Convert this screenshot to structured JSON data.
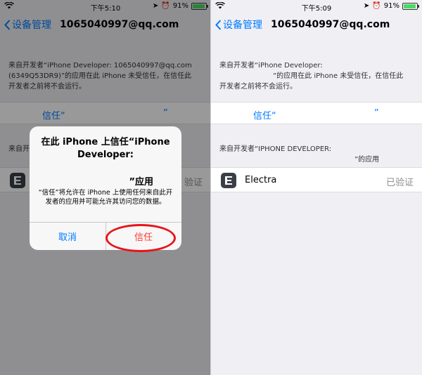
{
  "left": {
    "status": {
      "time": "下午5:10",
      "battery": "91%"
    },
    "nav": {
      "back": "设备管理",
      "title": "1065040997@qq.com"
    },
    "desc": [
      "来自开发者“iPhone Developer: 1065040997@qq.com",
      "(6349Q53DR9)”的应用在此 iPhone 未受信任，在信任此",
      "开发者之前将不会运行。"
    ],
    "trust_label": "信任“",
    "trust_close": "”",
    "section2": "来自开发者",
    "app_status": "验证",
    "alert": {
      "title_line1": "在此 iPhone 上信任“iPhone",
      "title_line2": "Developer:",
      "app_suffix": "”应用",
      "message": "“信任”将允许在 iPhone 上使用任何来自此开发者的应用并可能允许其访问您的数据。",
      "cancel": "取消",
      "trust": "信任"
    }
  },
  "right": {
    "status": {
      "time": "下午5:09",
      "battery": "91%"
    },
    "nav": {
      "back": "设备管理",
      "title": "1065040997@qq.com"
    },
    "desc": [
      "来自开发者“iPhone Developer:",
      "”的应用在此 iPhone 未受信任，在信任此",
      "开发者之前将不会运行。"
    ],
    "trust_label": "信任“",
    "trust_close": "”",
    "section2_line1": "来自开发者“IPHONE DEVELOPER:",
    "section2_line2": "”的应用",
    "app_name": "Electra",
    "app_status": "已验证"
  },
  "colors": {
    "accent": "#007aff",
    "destructive": "#ff3b30",
    "highlight_circle": "#e8141a",
    "battery": "#4cd964"
  },
  "battery_level": 0.91
}
